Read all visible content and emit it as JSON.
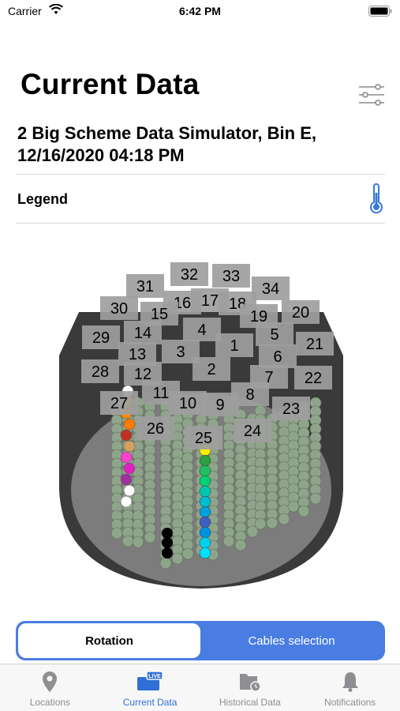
{
  "status_bar": {
    "carrier": "Carrier",
    "time": "6:42 PM"
  },
  "header": {
    "title": "Current Data",
    "subtitle": "2 Big Scheme Data Simulator, Bin E, 12/16/2020 04:18 PM",
    "filter_icon": "sliders-icon"
  },
  "legend": {
    "label": "Legend",
    "icon": "thermometer-icon"
  },
  "cables": {
    "labels": [
      "31",
      "32",
      "33",
      "34",
      "30",
      "16",
      "17",
      "18",
      "20",
      "15",
      "19",
      "29",
      "14",
      "4",
      "5",
      "21",
      "1",
      "13",
      "3",
      "6",
      "28",
      "12",
      "2",
      "7",
      "22",
      "11",
      "8",
      "27",
      "10",
      "9",
      "23",
      "26",
      "25",
      "24"
    ]
  },
  "segmented": {
    "rotation_label": "Rotation",
    "cables_label": "Cables selection",
    "selected": "Rotation"
  },
  "tabs": [
    {
      "label": "Locations",
      "icon": "location-pin-icon"
    },
    {
      "label": "Current Data",
      "icon": "live-tv-icon",
      "active": true
    },
    {
      "label": "Historical Data",
      "icon": "folder-clock-icon"
    },
    {
      "label": "Notifications",
      "icon": "bell-icon"
    }
  ],
  "colors": {
    "accent": "#4a7de2",
    "tab_active": "#2f6fd6",
    "bin_wall": "#3a3a3a",
    "bin_floor": "#7c7c7c",
    "sensor_default": "#8fa58b"
  }
}
